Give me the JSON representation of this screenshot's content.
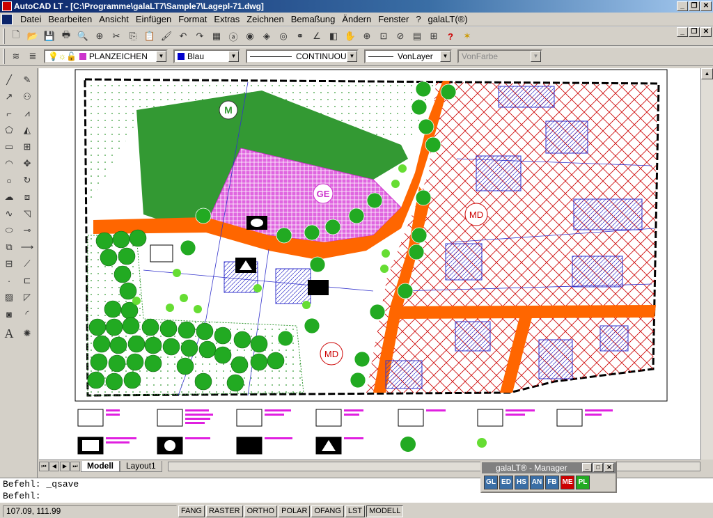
{
  "window": {
    "title": "AutoCAD LT - [C:\\Programme\\galaLT7\\Sample7\\Lagepl-71.dwg]"
  },
  "menu": [
    "Datei",
    "Bearbeiten",
    "Ansicht",
    "Einfügen",
    "Format",
    "Extras",
    "Zeichnen",
    "Bemaßung",
    "Ändern",
    "Fenster",
    "?",
    "galaLT(®)"
  ],
  "props": {
    "layer": "PLANZEICHEN",
    "color": "Blau",
    "linetype": "CONTINUOUS",
    "lineweight": "VonLayer",
    "plotstyle": "VonFarbe"
  },
  "drawing": {
    "labels": {
      "md1": "MD",
      "md2": "MD",
      "ge": "GE",
      "m": "M"
    },
    "colors": {
      "magenta": "#cc33cc",
      "green": "#339933",
      "orange": "#ff6600",
      "red": "#cc0000",
      "blue": "#3333cc",
      "tree": "#22aa22"
    }
  },
  "tabs": [
    "Modell",
    "Layout1"
  ],
  "command": {
    "line1": "Befehl: _qsave",
    "line2": "Befehl:"
  },
  "status": {
    "coords": "107.09, 111.99",
    "buttons": [
      "FANG",
      "RASTER",
      "ORTHO",
      "POLAR",
      "OFANG",
      "LST",
      "MODELL"
    ]
  },
  "manager": {
    "title": "galaLT® - Manager",
    "tools": [
      "GL",
      "ED",
      "HS",
      "AN",
      "FB",
      "ME",
      "PL"
    ]
  }
}
